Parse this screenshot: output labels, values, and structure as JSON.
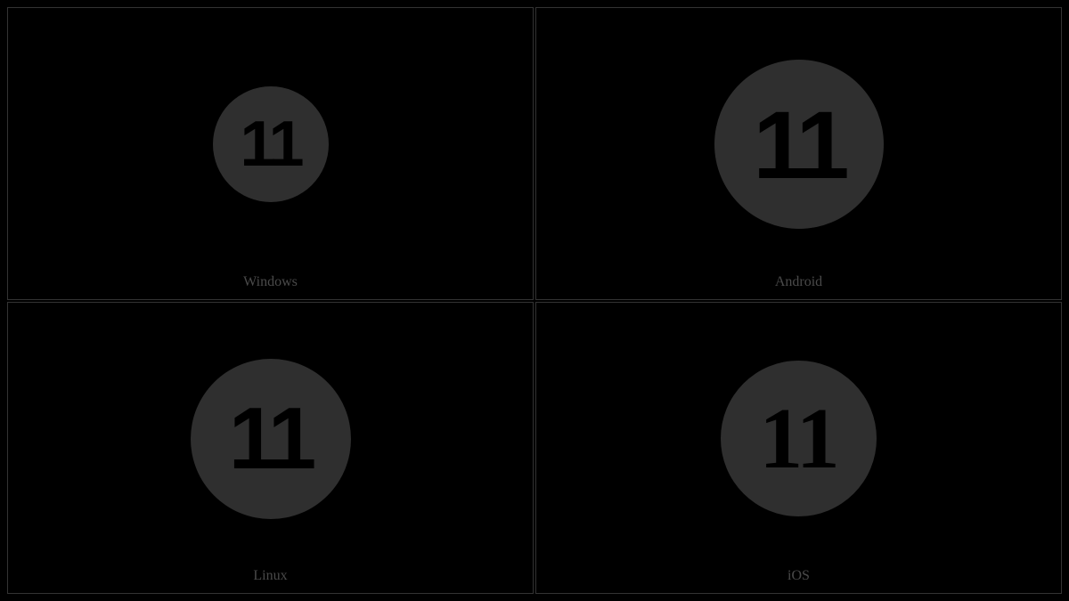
{
  "glyph_number": "11",
  "cells": [
    {
      "label": "Windows",
      "class": "circle-windows"
    },
    {
      "label": "Android",
      "class": "circle-android"
    },
    {
      "label": "Linux",
      "class": "circle-linux"
    },
    {
      "label": "iOS",
      "class": "circle-ios"
    }
  ]
}
